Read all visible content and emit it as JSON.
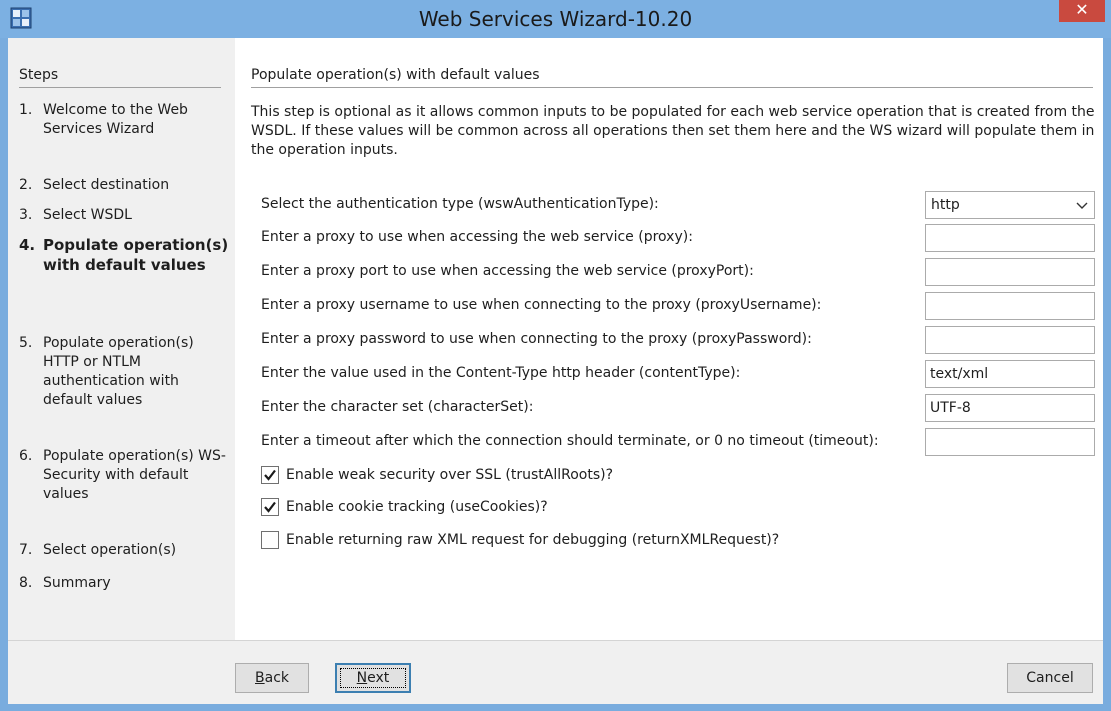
{
  "window": {
    "title": "Web Services Wizard-10.20",
    "close_label": "✕"
  },
  "steps": {
    "heading": "Steps",
    "items": [
      {
        "num": "1.",
        "label": "Welcome to the Web Services Wizard"
      },
      {
        "num": "2.",
        "label": "Select destination"
      },
      {
        "num": "3.",
        "label": "Select WSDL"
      },
      {
        "num": "4.",
        "label": "Populate operation(s) with default values",
        "current": true
      },
      {
        "num": "5.",
        "label": "Populate operation(s) HTTP or NTLM authentication with default values"
      },
      {
        "num": "6.",
        "label": "Populate operation(s) WS-Security with default values"
      },
      {
        "num": "7.",
        "label": "Select operation(s)"
      },
      {
        "num": "8.",
        "label": "Summary"
      }
    ]
  },
  "content": {
    "heading": "Populate operation(s) with default values",
    "description": "This step is optional as it allows common inputs to be populated for each web service operation that is created from the WSDL. If these values will be common across all operations then set them here and the WS wizard will populate them in the operation inputs.",
    "fields": [
      {
        "label": "Select the authentication type (wswAuthenticationType):",
        "type": "select",
        "value": "http"
      },
      {
        "label": "Enter a proxy to use when accessing the web service (proxy):",
        "type": "text",
        "value": ""
      },
      {
        "label": "Enter a proxy port to use when accessing the web service (proxyPort):",
        "type": "text",
        "value": ""
      },
      {
        "label": "Enter a proxy username to use when connecting to the proxy (proxyUsername):",
        "type": "text",
        "value": ""
      },
      {
        "label": "Enter a proxy password to use when connecting to the proxy (proxyPassword):",
        "type": "text",
        "value": ""
      },
      {
        "label": "Enter the value used in the Content-Type http header (contentType):",
        "type": "text",
        "value": "text/xml"
      },
      {
        "label": "Enter the character set (characterSet):",
        "type": "text",
        "value": "UTF-8"
      },
      {
        "label": "Enter a timeout after which the connection should terminate, or 0 no timeout (timeout):",
        "type": "text",
        "value": ""
      }
    ],
    "checkboxes": [
      {
        "label": "Enable weak security over SSL (trustAllRoots)?",
        "checked": true
      },
      {
        "label": "Enable cookie tracking (useCookies)?",
        "checked": true
      },
      {
        "label": "Enable returning raw XML request for debugging (returnXMLRequest)?",
        "checked": false
      }
    ]
  },
  "footer": {
    "back_mnemonic": "B",
    "back_rest": "ack",
    "next_mnemonic": "N",
    "next_rest": "ext",
    "cancel_label": "Cancel"
  },
  "icons": {
    "app": "app-icon",
    "close": "close-icon",
    "dropdown": "chevron-down-icon",
    "check": "checkmark-icon"
  }
}
